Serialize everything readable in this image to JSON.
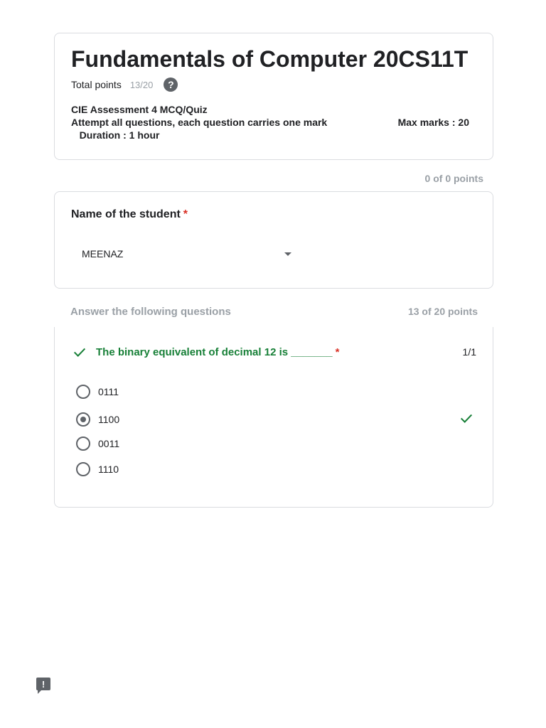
{
  "header": {
    "title": "Fundamentals of Computer 20CS11T",
    "total_points_label": "Total points",
    "total_points_value": "13/20",
    "help_glyph": "?",
    "description": {
      "line1": "CIE Assessment 4 MCQ/Quiz",
      "line2_left": "Attempt all questions, each question carries one mark",
      "line2_right": "Max marks : 20",
      "line3": "   Duration : 1 hour"
    }
  },
  "section1": {
    "points": "0 of 0 points",
    "question": {
      "title": "Name of the student",
      "required_mark": "*",
      "selected_value": "MEENAZ"
    }
  },
  "section2": {
    "title": "Answer the following questions",
    "points": "13 of 20 points",
    "question": {
      "title": "The binary equivalent of decimal 12 is  _______",
      "required_mark": "*",
      "score": "1/1",
      "status": "correct",
      "options": [
        {
          "label": "0111",
          "selected": false
        },
        {
          "label": "1100",
          "selected": true,
          "correct": true
        },
        {
          "label": "0011",
          "selected": false
        },
        {
          "label": "1110",
          "selected": false
        }
      ]
    }
  },
  "colors": {
    "correct": "#188038",
    "required": "#d93025",
    "muted": "#9aa0a6",
    "border": "#dadce0"
  },
  "icons": {
    "help": "help-circle-icon",
    "dropdown": "dropdown-arrow-icon",
    "check": "checkmark-icon",
    "feedback": "feedback-icon"
  },
  "feedback_glyph": "!"
}
